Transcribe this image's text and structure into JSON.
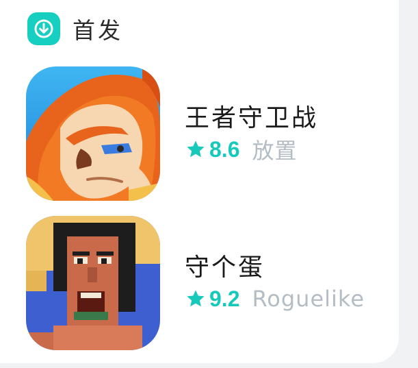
{
  "section": {
    "title": "首发",
    "icon": "download-icon",
    "accent_color": "#16cfc1"
  },
  "games": [
    {
      "title": "王者守卫战",
      "rating": "8.6",
      "genre": "放置",
      "icon": "lion-warrior-app-icon"
    },
    {
      "title": "守个蛋",
      "rating": "9.2",
      "genre": "Roguelike",
      "icon": "pixel-straw-hat-man-app-icon"
    }
  ],
  "colors": {
    "rating": "#16c9bb",
    "genre": "#b4bcc4",
    "title": "#1a1a1a"
  }
}
